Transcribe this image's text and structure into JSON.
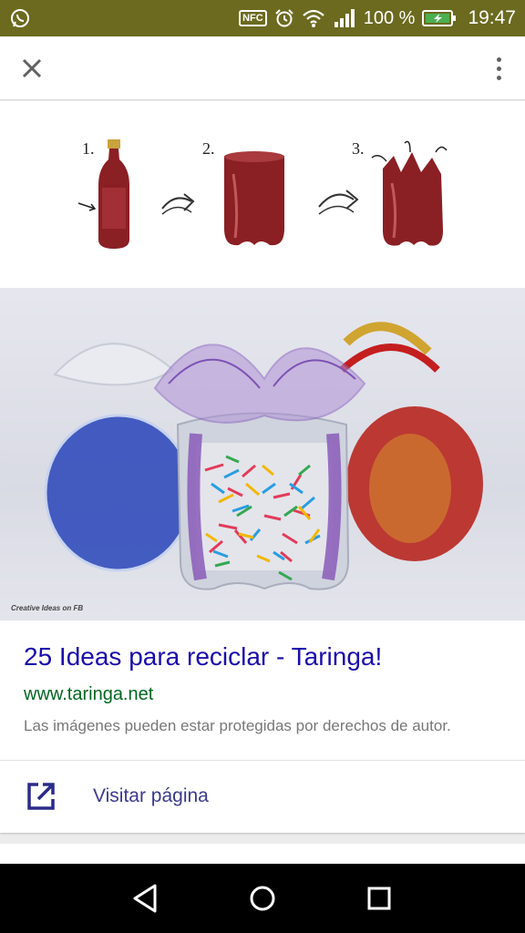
{
  "status_bar": {
    "nfc_label": "NFC",
    "battery_percent": "100 %",
    "time": "19:47",
    "icons": [
      "whatsapp-icon",
      "nfc-icon",
      "alarm-icon",
      "wifi-icon",
      "signal-icon",
      "battery-charging-icon"
    ],
    "background": "#6b6a1f"
  },
  "app_bar": {
    "close_icon": "close-icon",
    "menu_icon": "more-vert-icon"
  },
  "image": {
    "steps": [
      "1.",
      "2.",
      "3."
    ],
    "watermark": "Creative Ideas on FB"
  },
  "result": {
    "title": "25 Ideas para reciclar - Taringa!",
    "url": "www.taringa.net",
    "copyright_note": "Las imágenes pueden estar protegidas por derechos de autor.",
    "visit_label": "Visitar página",
    "title_color": "#1a0dab",
    "url_color": "#006621"
  },
  "nav_bar": {
    "back_icon": "back-icon",
    "home_icon": "home-icon",
    "recents_icon": "recents-icon"
  }
}
